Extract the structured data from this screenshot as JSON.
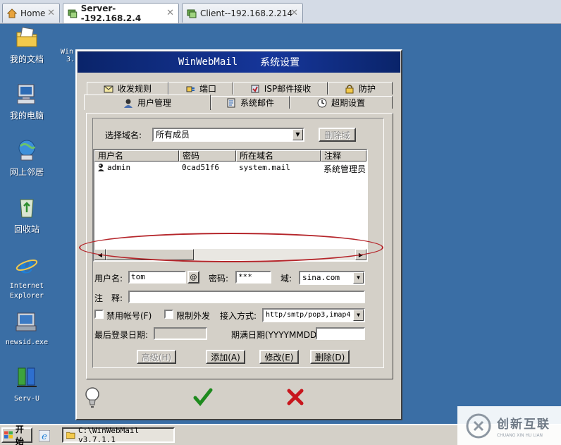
{
  "browser_tabs": [
    {
      "label": "Home"
    },
    {
      "label": "Server--192.168.2.4"
    },
    {
      "label": "Client--192.168.2.214"
    }
  ],
  "desktop_icons": [
    {
      "label": "我的文档",
      "icon": "folder-docs-icon"
    },
    {
      "label": "我的电脑",
      "icon": "computer-icon"
    },
    {
      "label": "网上邻居",
      "icon": "network-icon"
    },
    {
      "label": "回收站",
      "icon": "recycle-bin-icon"
    },
    {
      "label": "Internet\nExplorer",
      "icon": "internet-explorer-icon"
    },
    {
      "label": "newsid.exe",
      "icon": "exe-icon"
    },
    {
      "label": "Serv-U",
      "icon": "servu-icon"
    }
  ],
  "desktop_partial_icon": {
    "line1": "Win",
    "line2": "3."
  },
  "dialog": {
    "app_name": "WinWebMail",
    "title": "系统设置",
    "tabs_back": [
      "收发规则",
      "端口",
      "ISP邮件接收",
      "防护"
    ],
    "tabs_front": [
      "用户管理",
      "系统邮件",
      "超期设置"
    ],
    "domain_label": "选择域名:",
    "domain_value": "所有成员",
    "delete_domain_button": "删除域",
    "list_headers": [
      "用户名",
      "密码",
      "所在域名",
      "注释"
    ],
    "list_rows": [
      {
        "username": "admin",
        "password": "0cad51f6",
        "domain": "system.mail",
        "note": "系统管理员"
      }
    ],
    "username_label": "用户名:",
    "username_value": "tom",
    "at_button": "@",
    "password_label": "密码:",
    "password_value": "***",
    "domain_field_label": "域:",
    "domain_field_value": "sina.com",
    "note_label": "注　释:",
    "note_value": "",
    "disable_account_label": "禁用帐号(F)",
    "restrict_send_label": "限制外发",
    "access_label": "接入方式:",
    "access_value": "http/smtp/pop3,imap4",
    "last_login_label": "最后登录日期:",
    "last_login_value": "",
    "expire_label": "期满日期(YYYYMMDD):",
    "expire_value": "",
    "advanced_button": "高级(H)",
    "add_button": "添加(A)",
    "modify_button": "修改(E)",
    "delete_button": "删除(D)"
  },
  "taskbar": {
    "start_label": "开始",
    "task_label": "C:\\WinWebMail v3.7.1.1"
  },
  "watermark": {
    "text": "创新互联",
    "sub": "CHUANG XIN HU LIAN"
  },
  "colors": {
    "desktop": "#3a6ea5",
    "dialog_bg": "#d4d0c8",
    "title_bar": "#0a246a",
    "highlight_ring": "#b5262b",
    "ok_green": "#1e8a1e",
    "cancel_red": "#c8161d"
  }
}
